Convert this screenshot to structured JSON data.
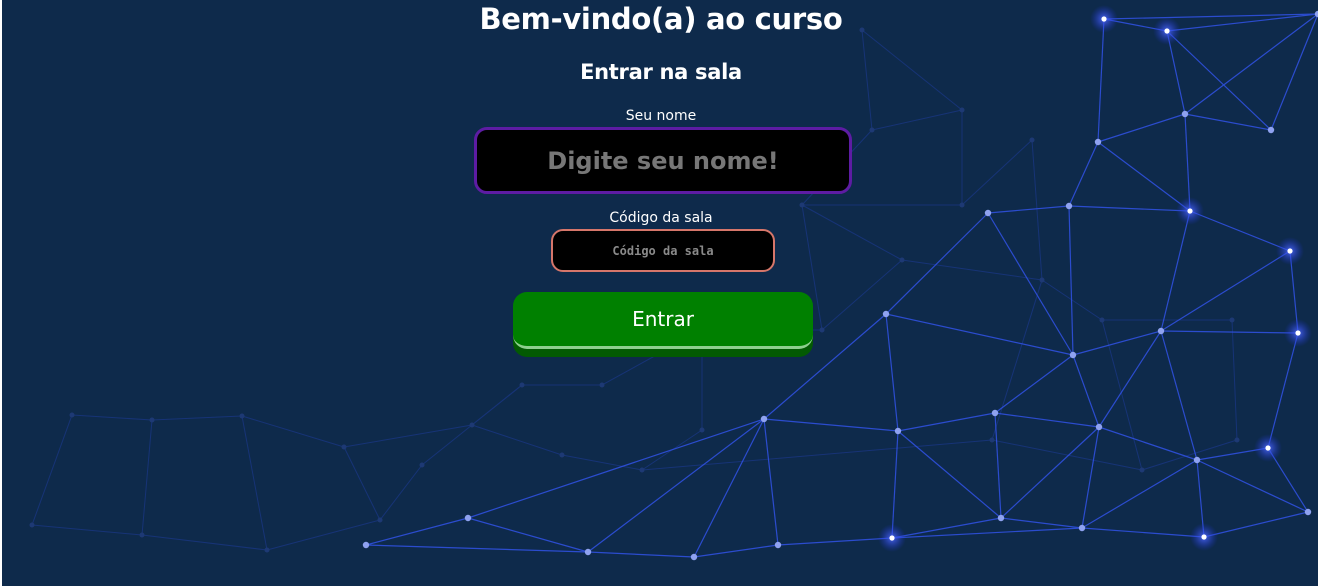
{
  "page": {
    "title": "Bem-vindo(a) ao curso",
    "subtitle": "Entrar na sala"
  },
  "form": {
    "name_label": "Seu nome",
    "name_placeholder": "Digite seu nome!",
    "name_value": "",
    "code_label": "Código da sala",
    "code_placeholder": "Código da sala",
    "code_value": "",
    "submit_label": "Entrar"
  },
  "colors": {
    "background": "#0e2a4b",
    "network_lines": "#2f4de0",
    "network_nodes": "#8fa2f0",
    "name_input_border": "#5d1ca3",
    "code_input_border": "#d6766a",
    "submit_button": "#008000"
  }
}
